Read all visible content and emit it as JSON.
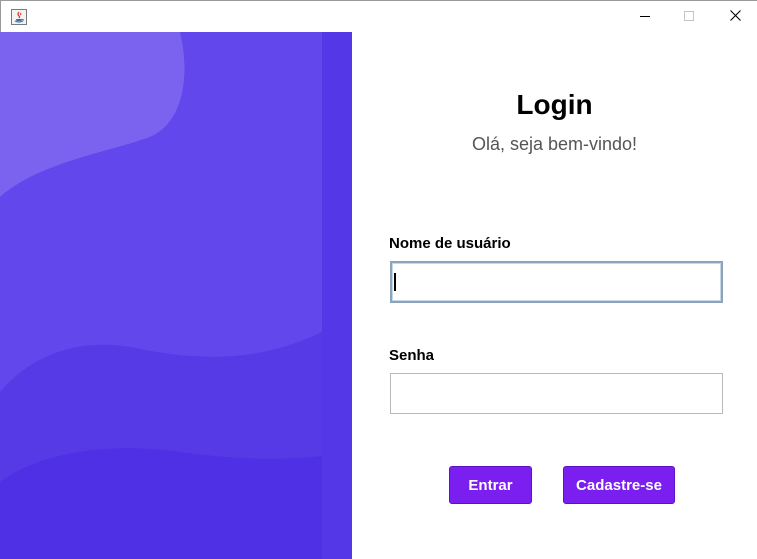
{
  "window": {
    "title": "",
    "controls": {
      "minimize": "minimize-icon",
      "maximize": "maximize-icon",
      "close": "close-icon"
    }
  },
  "side_panel": {
    "colors": {
      "base": "#5a3ee8",
      "light_wave": "#7b63f0",
      "mid_wave": "#6a4fec",
      "dark_wave": "#4f30e4"
    }
  },
  "login": {
    "title": "Login",
    "subtitle": "Olá, seja bem-vindo!",
    "username": {
      "label": "Nome de usuário",
      "value": "",
      "placeholder": ""
    },
    "password": {
      "label": "Senha",
      "value": "",
      "placeholder": ""
    },
    "buttons": {
      "login": "Entrar",
      "signup": "Cadastre-se"
    },
    "accent_color": "#7a1ff0"
  }
}
